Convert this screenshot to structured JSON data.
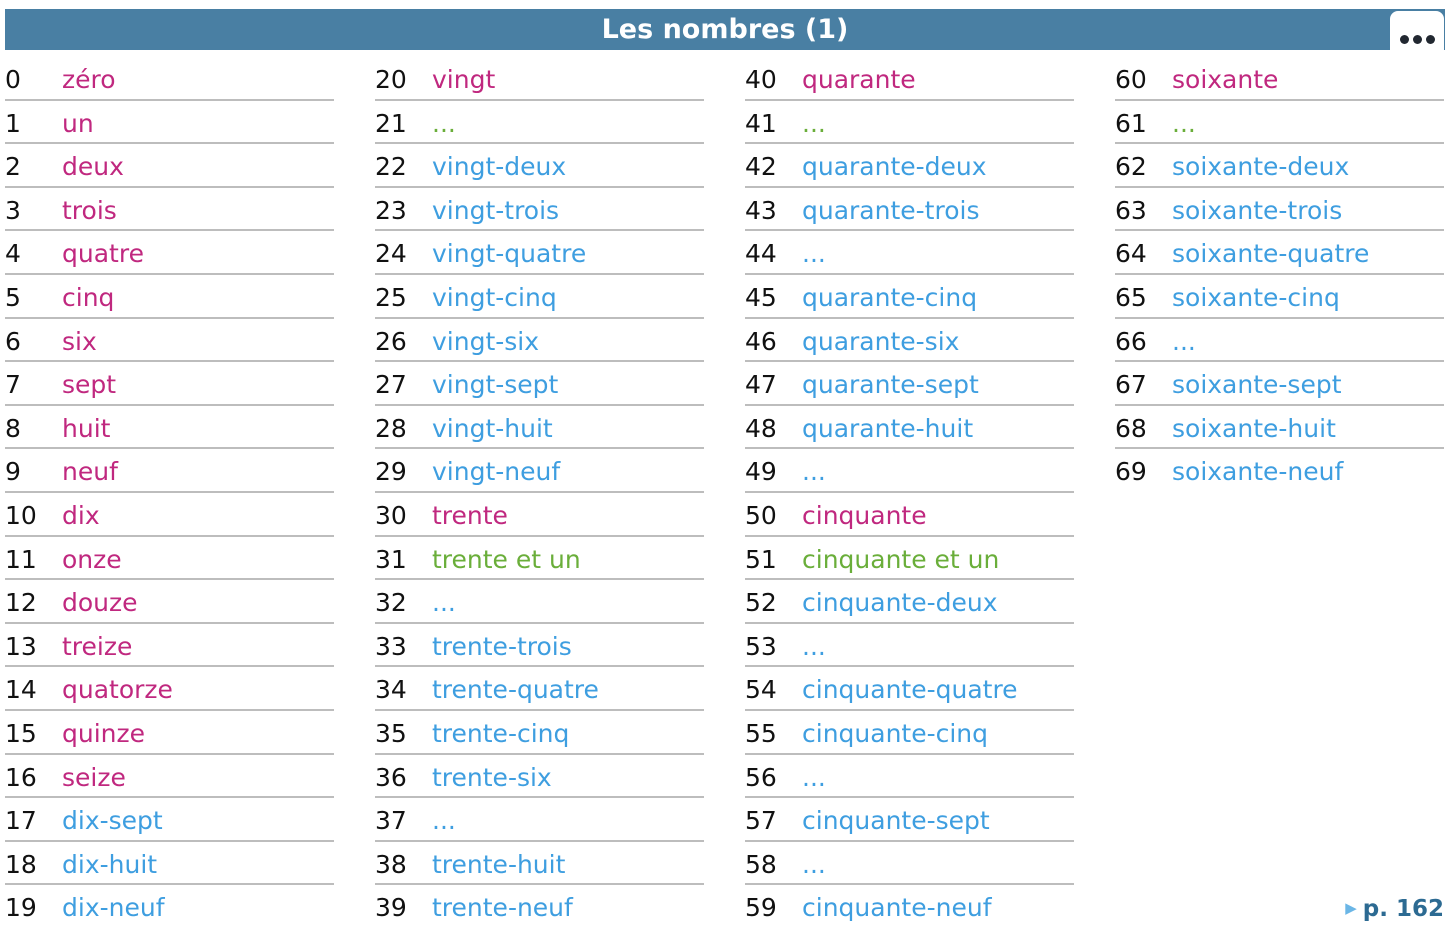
{
  "header": {
    "title": "Les nombres (1)",
    "menu_icon": "more-horizontal-icon"
  },
  "colors": {
    "p": "#c0287f",
    "b": "#3e9ee0",
    "g": "#6aae3a",
    "header": "#497fa3"
  },
  "columns": [
    [
      [
        "0",
        "zéro",
        "p"
      ],
      [
        "1",
        "un",
        "p"
      ],
      [
        "2",
        "deux",
        "p"
      ],
      [
        "3",
        "trois",
        "p"
      ],
      [
        "4",
        "quatre",
        "p"
      ],
      [
        "5",
        "cinq",
        "p"
      ],
      [
        "6",
        "six",
        "p"
      ],
      [
        "7",
        "sept",
        "p"
      ],
      [
        "8",
        "huit",
        "p"
      ],
      [
        "9",
        "neuf",
        "p"
      ],
      [
        "10",
        "dix",
        "p"
      ],
      [
        "11",
        "onze",
        "p"
      ],
      [
        "12",
        "douze",
        "p"
      ],
      [
        "13",
        "treize",
        "p"
      ],
      [
        "14",
        "quatorze",
        "p"
      ],
      [
        "15",
        "quinze",
        "p"
      ],
      [
        "16",
        "seize",
        "p"
      ],
      [
        "17",
        "dix-sept",
        "b"
      ],
      [
        "18",
        "dix-huit",
        "b"
      ],
      [
        "19",
        "dix-neuf",
        "b"
      ]
    ],
    [
      [
        "20",
        "vingt",
        "p"
      ],
      [
        "21",
        "...",
        "g"
      ],
      [
        "22",
        "vingt-deux",
        "b"
      ],
      [
        "23",
        "vingt-trois",
        "b"
      ],
      [
        "24",
        "vingt-quatre",
        "b"
      ],
      [
        "25",
        "vingt-cinq",
        "b"
      ],
      [
        "26",
        "vingt-six",
        "b"
      ],
      [
        "27",
        "vingt-sept",
        "b"
      ],
      [
        "28",
        "vingt-huit",
        "b"
      ],
      [
        "29",
        "vingt-neuf",
        "b"
      ],
      [
        "30",
        "trente",
        "p"
      ],
      [
        "31",
        "trente et un",
        "g"
      ],
      [
        "32",
        "...",
        "b"
      ],
      [
        "33",
        "trente-trois",
        "b"
      ],
      [
        "34",
        "trente-quatre",
        "b"
      ],
      [
        "35",
        "trente-cinq",
        "b"
      ],
      [
        "36",
        "trente-six",
        "b"
      ],
      [
        "37",
        "...",
        "b"
      ],
      [
        "38",
        "trente-huit",
        "b"
      ],
      [
        "39",
        "trente-neuf",
        "b"
      ]
    ],
    [
      [
        "40",
        "quarante",
        "p"
      ],
      [
        "41",
        "...",
        "g"
      ],
      [
        "42",
        "quarante-deux",
        "b"
      ],
      [
        "43",
        "quarante-trois",
        "b"
      ],
      [
        "44",
        "...",
        "b"
      ],
      [
        "45",
        "quarante-cinq",
        "b"
      ],
      [
        "46",
        "quarante-six",
        "b"
      ],
      [
        "47",
        "quarante-sept",
        "b"
      ],
      [
        "48",
        "quarante-huit",
        "b"
      ],
      [
        "49",
        "...",
        "b"
      ],
      [
        "50",
        "cinquante",
        "p"
      ],
      [
        "51",
        "cinquante et un",
        "g"
      ],
      [
        "52",
        "cinquante-deux",
        "b"
      ],
      [
        "53",
        "...",
        "b"
      ],
      [
        "54",
        "cinquante-quatre",
        "b"
      ],
      [
        "55",
        "cinquante-cinq",
        "b"
      ],
      [
        "56",
        "...",
        "b"
      ],
      [
        "57",
        "cinquante-sept",
        "b"
      ],
      [
        "58",
        "...",
        "b"
      ],
      [
        "59",
        "cinquante-neuf",
        "b"
      ]
    ],
    [
      [
        "60",
        "soixante",
        "p"
      ],
      [
        "61",
        "...",
        "g"
      ],
      [
        "62",
        "soixante-deux",
        "b"
      ],
      [
        "63",
        "soixante-trois",
        "b"
      ],
      [
        "64",
        "soixante-quatre",
        "b"
      ],
      [
        "65",
        "soixante-cinq",
        "b"
      ],
      [
        "66",
        "...",
        "b"
      ],
      [
        "67",
        "soixante-sept",
        "b"
      ],
      [
        "68",
        "soixante-huit",
        "b"
      ],
      [
        "69",
        "soixante-neuf",
        "b"
      ]
    ]
  ],
  "footer": {
    "page_ref": "p. 162",
    "arrow_icon": "triangle-right-icon"
  }
}
